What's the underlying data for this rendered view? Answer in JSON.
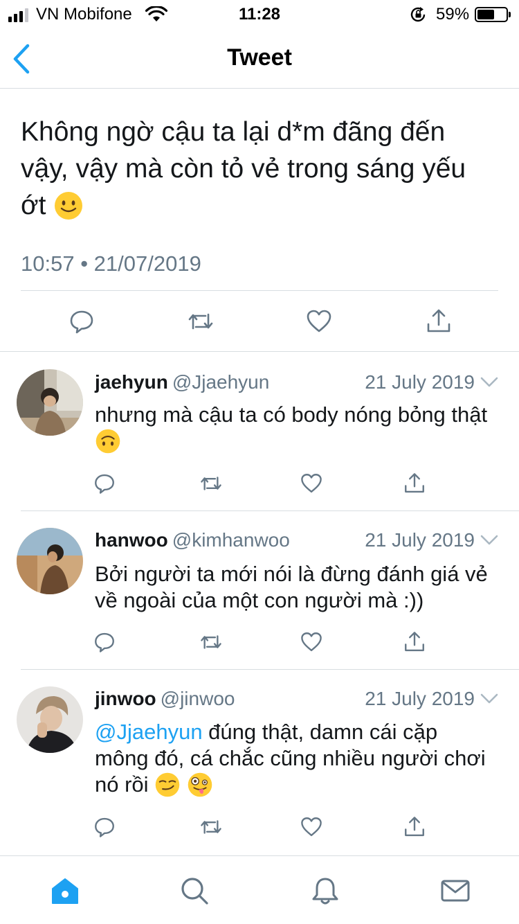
{
  "status_bar": {
    "carrier": "VN Mobifone",
    "time": "11:28",
    "battery_percent_label": "59%",
    "battery_level": 0.59,
    "signal_bars_filled": 3,
    "signal_bars_total": 4
  },
  "nav": {
    "title": "Tweet",
    "back_icon": "chevron-left-icon"
  },
  "main_tweet": {
    "text": "Không ngờ cậu ta lại d*m đãng đến vậy, vậy mà còn tỏ vẻ trong sáng yếu ớt",
    "emoji": "slightly-smiling-face",
    "timestamp": "10:57 • 21/07/2019",
    "actions": [
      "reply-icon",
      "retweet-icon",
      "like-icon",
      "share-icon"
    ]
  },
  "replies": [
    {
      "name": "jaehyun",
      "handle": "@Jjaehyun",
      "date": "21 July 2019",
      "text": "nhưng mà cậu ta có body nóng bỏng thật",
      "emoji": "upside-down-face"
    },
    {
      "name": "hanwoo",
      "handle": "@kimhanwoo",
      "date": "21 July 2019",
      "text": "Bởi người ta mới nói là đừng đánh giá vẻ về ngoài của một con người mà :))"
    },
    {
      "name": "jinwoo",
      "handle": "@jinwoo",
      "date": "21 July 2019",
      "mention": "@Jjaehyun",
      "text": " đúng thật, damn cái cặp mông đó, cá chắc cũng nhiều người chơi nó rồi",
      "emojis": [
        "smirking-face",
        "zany-face"
      ]
    }
  ],
  "tab_bar": {
    "tabs": [
      "home-icon",
      "search-icon",
      "notifications-icon",
      "messages-icon"
    ],
    "active": "home-icon"
  },
  "colors": {
    "accent": "#1da1f2",
    "text": "#14171a",
    "secondary": "#657786",
    "divider": "#d8dde1"
  }
}
